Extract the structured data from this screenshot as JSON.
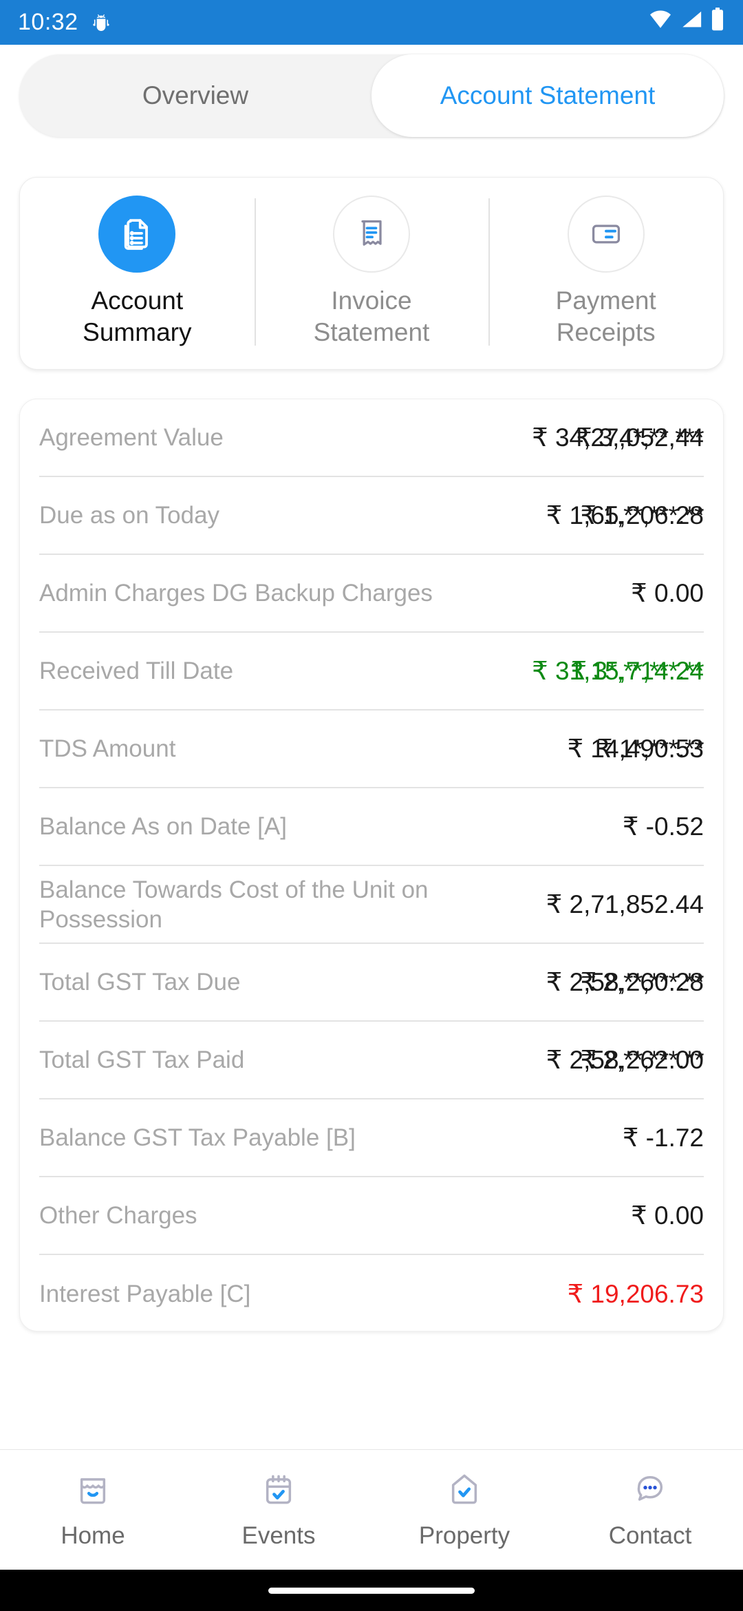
{
  "status_bar": {
    "time": "10:32",
    "icons": [
      "android-bug-icon",
      "wifi-icon",
      "signal-icon",
      "battery-icon"
    ],
    "background": "#1b7fd4"
  },
  "tabs": {
    "items": [
      {
        "label": "Overview",
        "active": false
      },
      {
        "label": "Account Statement",
        "active": true
      }
    ],
    "active_color": "#2196f3"
  },
  "shortcuts": [
    {
      "label": "Account\nSummary",
      "line1": "Account",
      "line2": "Summary",
      "icon": "documents-list-icon",
      "active": true
    },
    {
      "label": "Invoice\nStatement",
      "line1": "Invoice",
      "line2": "Statement",
      "icon": "invoice-receipt-icon",
      "active": false
    },
    {
      "label": "Payment\nReceipts",
      "line1": "Payment",
      "line2": "Receipts",
      "icon": "payment-card-icon",
      "active": false
    }
  ],
  "summary": {
    "rows": [
      {
        "label": "Agreement Value",
        "value": "₹ 34,27,052.44",
        "masked": "₹ 3,4*,**,***",
        "overlap": true,
        "color": "default"
      },
      {
        "label": "Due as on Today",
        "value": "₹ 1,65,206.28",
        "masked": "₹ 1,**,***.**",
        "overlap": true,
        "color": "default"
      },
      {
        "label": "Admin Charges DG Backup Charges",
        "value": "₹ 0.00",
        "masked": "",
        "overlap": false,
        "color": "default"
      },
      {
        "label": "Received Till Date",
        "value": "₹ 31,15,714.24",
        "masked": "₹ 3*,**,***.**",
        "overlap": true,
        "color": "green"
      },
      {
        "label": "TDS Amount",
        "value": "₹ 14,490.53",
        "masked": "₹ 1*,***.**",
        "overlap": true,
        "color": "default"
      },
      {
        "label": "Balance As on Date [A]",
        "value": "₹ -0.52",
        "masked": "",
        "overlap": false,
        "color": "default"
      },
      {
        "label": "Balance Towards Cost of the Unit on Possession",
        "value": "₹ 2,71,852.44",
        "masked": "",
        "overlap": false,
        "color": "default"
      },
      {
        "label": "Total GST Tax Due",
        "value": "₹ 2,58,260.28",
        "masked": "₹ 2,**,***.**",
        "overlap": true,
        "color": "default"
      },
      {
        "label": "Total GST Tax Paid",
        "value": "₹ 2,58,262.00",
        "masked": "₹ 2,**,***.**",
        "overlap": true,
        "color": "default"
      },
      {
        "label": "Balance GST Tax Payable [B]",
        "value": "₹ -1.72",
        "masked": "",
        "overlap": false,
        "color": "default"
      },
      {
        "label": "Other Charges",
        "value": "₹ 0.00",
        "masked": "",
        "overlap": false,
        "color": "default"
      },
      {
        "label": "Interest Payable [C]",
        "value": "₹ 19,206.73",
        "masked": "",
        "overlap": false,
        "color": "red"
      }
    ],
    "colors": {
      "green": "#0e8a14",
      "red": "#f01b1b",
      "label": "#a8a8a8",
      "value": "#1a1a1a"
    }
  },
  "bottom_nav": [
    {
      "label": "Home",
      "icon": "store-home-icon"
    },
    {
      "label": "Events",
      "icon": "calendar-check-icon"
    },
    {
      "label": "Property",
      "icon": "house-check-icon"
    },
    {
      "label": "Contact",
      "icon": "dots-bubble-icon"
    }
  ]
}
